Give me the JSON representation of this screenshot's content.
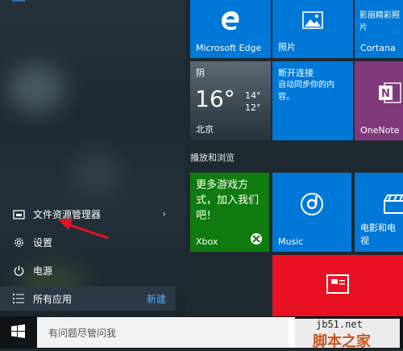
{
  "left": {
    "items": [
      {
        "label": "文件资源管理器",
        "icon": "folder-icon",
        "has_chevron": true
      },
      {
        "label": "设置",
        "icon": "gear-icon"
      },
      {
        "label": "电源",
        "icon": "power-icon"
      },
      {
        "label": "所有应用",
        "icon": "list-icon",
        "action": "新建"
      }
    ],
    "chevron": "›"
  },
  "tiles": {
    "edge": "Microsoft Edge",
    "photos": "照片",
    "news_line1": "影丽精彩照片",
    "cortana": "Cortana",
    "weather": {
      "cond": "阴",
      "temp": "16°",
      "hi": "14°",
      "lo": "12°",
      "city": "北京"
    },
    "conn": {
      "title": "断开连接",
      "body": "自动同步你的内容。"
    },
    "onenote": "OneNote",
    "group": "播放和浏览",
    "xbox": {
      "promo": "更多游戏方式，加入我们吧！",
      "name": "Xbox"
    },
    "music": "Music",
    "movies": "电影和电视"
  },
  "taskbar": {
    "search_placeholder": "有问题尽管问我"
  },
  "watermark": {
    "line1": "jb51.net",
    "line2": "脚本之家"
  },
  "colors": {
    "accent": "#0078d7",
    "xbox": "#107c10",
    "onenote": "#80397b",
    "red": "#e81123",
    "taskbar": "#101416"
  }
}
